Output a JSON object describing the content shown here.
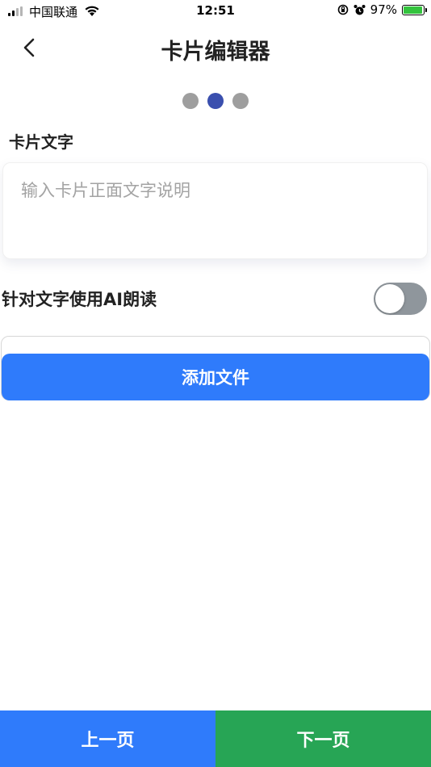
{
  "status_bar": {
    "carrier": "中国联通",
    "time": "12:51",
    "battery": "97%",
    "battery_level": 0.97,
    "signal_bars": 4,
    "signal_active": 2
  },
  "header": {
    "title": "卡片编辑器",
    "back_icon": "chevron-left-icon"
  },
  "steps": {
    "total": 3,
    "active_index": 1
  },
  "card_text": {
    "label": "卡片文字",
    "value": "",
    "placeholder": "输入卡片正面文字说明"
  },
  "ai_read": {
    "label": "针对文字使用AI朗读",
    "enabled": false
  },
  "add_file": {
    "label": "添加文件"
  },
  "footer": {
    "prev_label": "上一页",
    "next_label": "下一页"
  },
  "colors": {
    "primary": "#2f7bfb",
    "next_button": "#27a555",
    "active_dot": "#3a4fae",
    "inactive_dot": "#9e9e9e",
    "toggle_off": "#8f969c"
  }
}
